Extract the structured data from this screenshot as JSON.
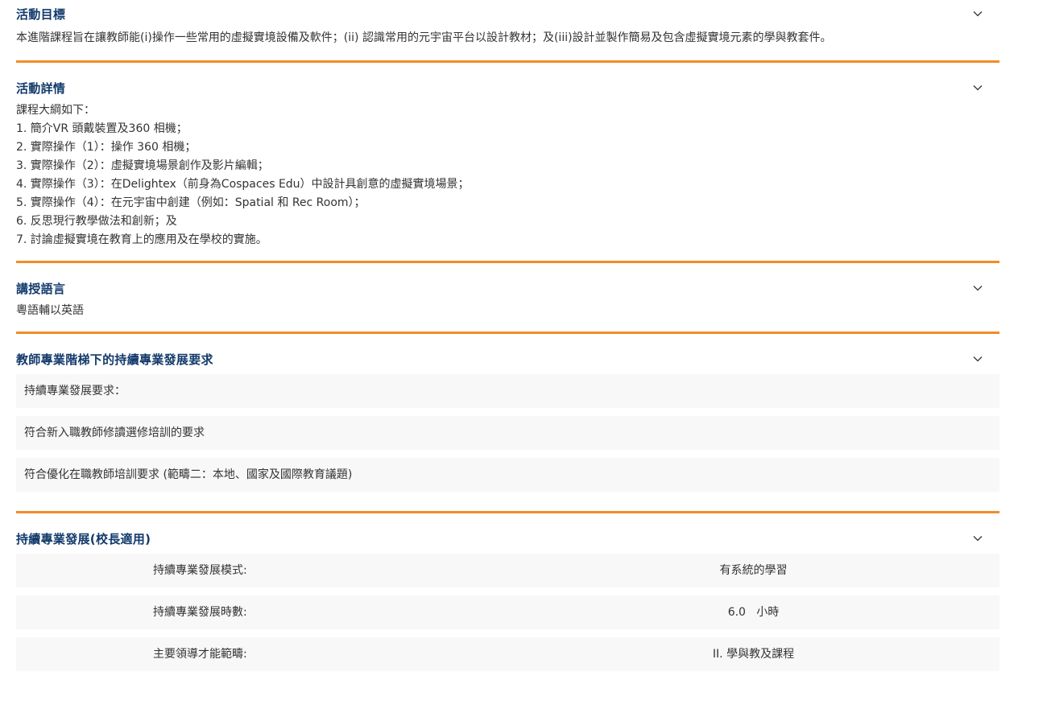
{
  "sections": {
    "objectives": {
      "title": "活動目標",
      "body": "本進階課程旨在讓教師能(i)操作一些常用的虛擬實境設備及軟件；(ii) 認識常用的元宇宙平台以設計教材；及(iii)設計並製作簡易及包含虛擬實境元素的學與教套件。"
    },
    "details": {
      "title": "活動詳情",
      "lines": [
        "課程大綱如下：",
        "1. 簡介VR 頭戴裝置及360 相機；",
        "2. 實際操作（1）：操作 360 相機；",
        "3. 實際操作（2）：虛擬實境場景創作及影片編輯；",
        "4. 實際操作（3）：在Delightex（前身為Cospaces Edu）中設計具創意的虛擬實境場景；",
        "5. 實際操作（4）：在元宇宙中創建（例如：Spatial 和 Rec Room）；",
        "6. 反思現行教學做法和創新；及",
        "7. 討論虛擬實境在教育上的應用及在學校的實施。"
      ]
    },
    "language": {
      "title": "講授語言",
      "body": "粵語輔以英語"
    },
    "cpd_ladder": {
      "title": "教師專業階梯下的持續專業發展要求",
      "rows": [
        "持續專業發展要求：",
        "符合新入職教師修讀選修培訓的要求",
        "符合優化在職教師培訓要求 (範疇二：本地、國家及國際教育議題)"
      ]
    },
    "cpd_principal": {
      "title": "持續專業發展(校長適用)",
      "rows": [
        {
          "label": "持續專業發展模式:",
          "value": "有系統的學習"
        },
        {
          "label": "持續專業發展時數:",
          "value": "6.0   小時"
        },
        {
          "label": "主要領導才能範疇:",
          "value": "II. 學與教及課程"
        }
      ]
    }
  },
  "icons": {
    "toggle": "chevron-down-icon"
  },
  "colors": {
    "accent": "#f28c28",
    "heading": "#123a6b",
    "row_bg": "#f8f8f8"
  }
}
